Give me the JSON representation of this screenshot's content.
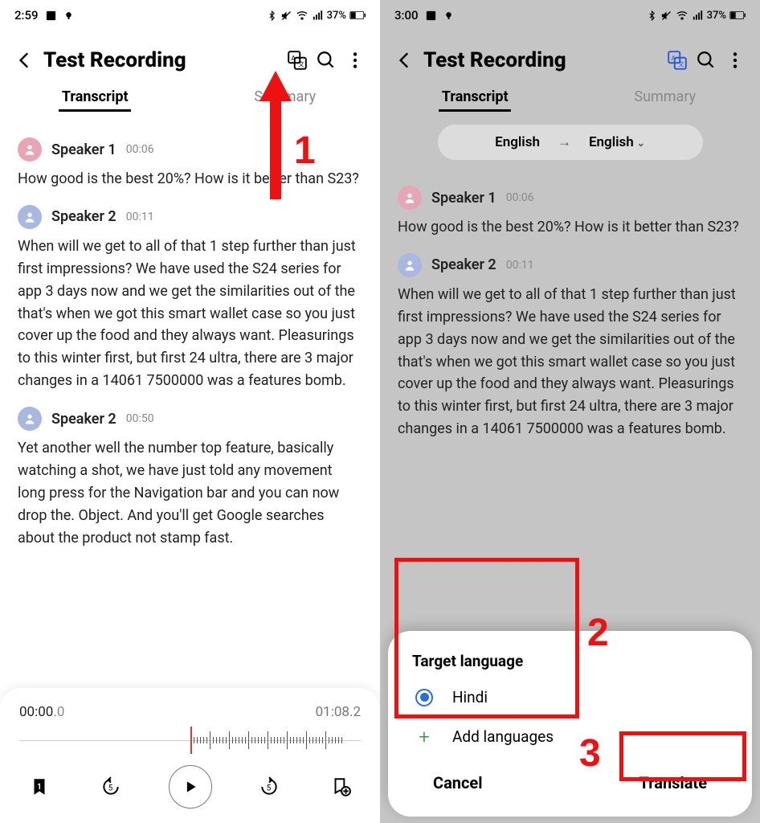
{
  "left": {
    "status": {
      "time": "2:59",
      "battery": "37%"
    },
    "title": "Test Recording",
    "tabs": {
      "transcript": "Transcript",
      "summary": "Summary"
    },
    "entries": [
      {
        "speaker": "Speaker 1",
        "color": "pink",
        "time": "00:06",
        "text": "How good is the best 20%? How is it better than S23?"
      },
      {
        "speaker": "Speaker 2",
        "color": "blue",
        "time": "00:11",
        "text": "When will we get to all of that 1 step further than just first impressions? We have used the S24 series for app 3 days now and we get the similarities out of the that's when we got this smart wallet case so you just cover up the food and they always want. Pleasurings to this winter first, but first 24 ultra, there are 3 major changes in a 14061 7500000 was a features bomb."
      },
      {
        "speaker": "Speaker 2",
        "color": "blue",
        "time": "00:50",
        "text": "Yet another well the number top feature, basically watching a shot, we have just told any movement long press for the Navigation bar and you can now drop the. Object. And you'll get Google searches about the product not stamp fast."
      }
    ],
    "player": {
      "current_main": "00:00",
      "current_dec": ".0",
      "total": "01:08.2",
      "bookmark_count": "1",
      "rewind_label": "5",
      "forward_label": "5"
    },
    "annot1": "1"
  },
  "right": {
    "status": {
      "time": "3:00",
      "battery": "37%"
    },
    "title": "Test Recording",
    "tabs": {
      "transcript": "Transcript",
      "summary": "Summary"
    },
    "lang": {
      "from": "English",
      "to": "English"
    },
    "entries": [
      {
        "speaker": "Speaker 1",
        "color": "pink",
        "time": "00:06",
        "text": "How good is the best 20%? How is it better than S23?"
      },
      {
        "speaker": "Speaker 2",
        "color": "blue",
        "time": "00:11",
        "text": "When will we get to all of that 1 step further than just first impressions? We have used the S24 series for app 3 days now and we get the similarities out of the that's when we got this smart wallet case so you just cover up the food and they always want. Pleasurings to this winter first, but first 24 ultra, there are 3 major changes in a 14061 7500000 was a features bomb."
      }
    ],
    "sheet": {
      "title": "Target language",
      "option": "Hindi",
      "add": "Add languages",
      "cancel": "Cancel",
      "translate": "Translate"
    },
    "annot2": "2",
    "annot3": "3"
  }
}
